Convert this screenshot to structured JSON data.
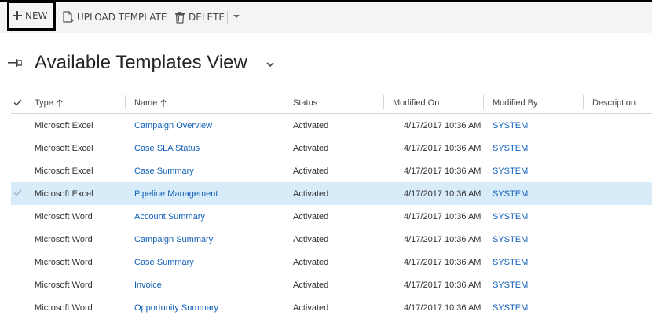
{
  "toolbar": {
    "new_label": "NEW",
    "upload_label": "UPLOAD TEMPLATE",
    "delete_label": "DELETE"
  },
  "view": {
    "title": "Available Templates View"
  },
  "grid": {
    "columns": {
      "type": "Type",
      "name": "Name",
      "status": "Status",
      "modified_on": "Modified On",
      "modified_by": "Modified By",
      "description": "Description"
    },
    "rows": [
      {
        "type": "Microsoft Excel",
        "name": "Campaign Overview",
        "status": "Activated",
        "modified_on": "4/17/2017 10:36 AM",
        "modified_by": "SYSTEM"
      },
      {
        "type": "Microsoft Excel",
        "name": "Case SLA Status",
        "status": "Activated",
        "modified_on": "4/17/2017 10:36 AM",
        "modified_by": "SYSTEM"
      },
      {
        "type": "Microsoft Excel",
        "name": "Case Summary",
        "status": "Activated",
        "modified_on": "4/17/2017 10:36 AM",
        "modified_by": "SYSTEM"
      },
      {
        "type": "Microsoft Excel",
        "name": "Pipeline Management",
        "status": "Activated",
        "modified_on": "4/17/2017 10:36 AM",
        "modified_by": "SYSTEM"
      },
      {
        "type": "Microsoft Word",
        "name": "Account Summary",
        "status": "Activated",
        "modified_on": "4/17/2017 10:36 AM",
        "modified_by": "SYSTEM"
      },
      {
        "type": "Microsoft Word",
        "name": "Campaign Summary",
        "status": "Activated",
        "modified_on": "4/17/2017 10:36 AM",
        "modified_by": "SYSTEM"
      },
      {
        "type": "Microsoft Word",
        "name": "Case Summary",
        "status": "Activated",
        "modified_on": "4/17/2017 10:36 AM",
        "modified_by": "SYSTEM"
      },
      {
        "type": "Microsoft Word",
        "name": "Invoice",
        "status": "Activated",
        "modified_on": "4/17/2017 10:36 AM",
        "modified_by": "SYSTEM"
      },
      {
        "type": "Microsoft Word",
        "name": "Opportunity Summary",
        "status": "Activated",
        "modified_on": "4/17/2017 10:36 AM",
        "modified_by": "SYSTEM"
      }
    ]
  },
  "colors": {
    "link": "#1160b7",
    "selected_row": "#d7ebf9",
    "toolbar_bg": "#f4f4f4"
  }
}
